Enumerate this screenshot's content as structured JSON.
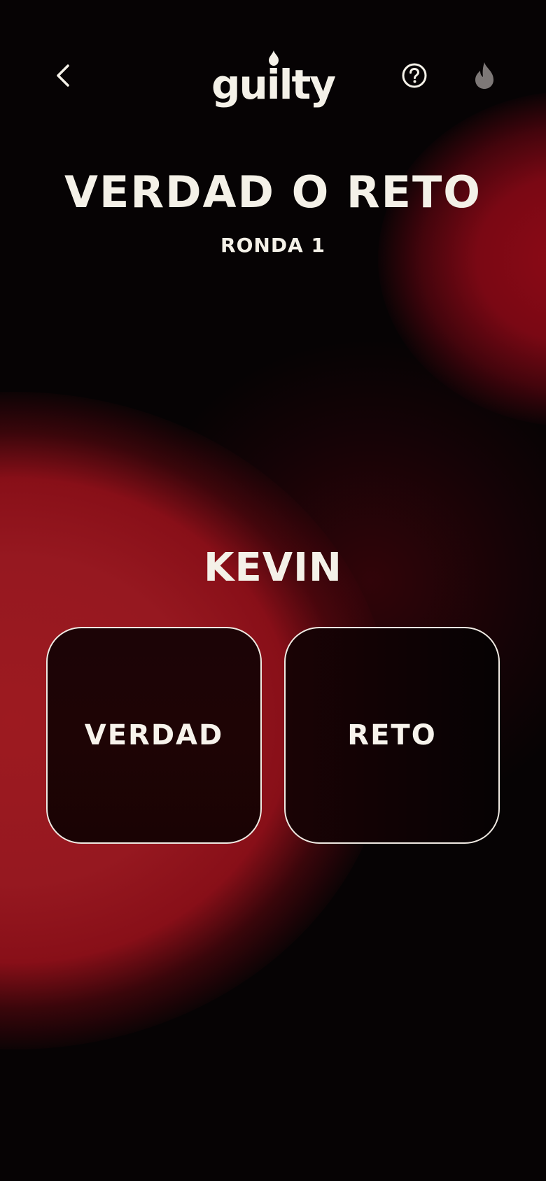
{
  "header": {
    "logo_text": "guilty",
    "back_icon": "chevron-left-icon",
    "help_icon": "question-circle-icon",
    "fire_icon": "flame-icon"
  },
  "game": {
    "title": "VERDAD O RETO",
    "round": "RONDA 1",
    "player": "KEVIN"
  },
  "choices": {
    "truth_label": "VERDAD",
    "dare_label": "RETO"
  },
  "colors": {
    "text": "#f4f1e8",
    "background": "#060304",
    "accent_red": "#9d1a20",
    "card": "#1c0406",
    "flame_muted": "#7d7877"
  }
}
